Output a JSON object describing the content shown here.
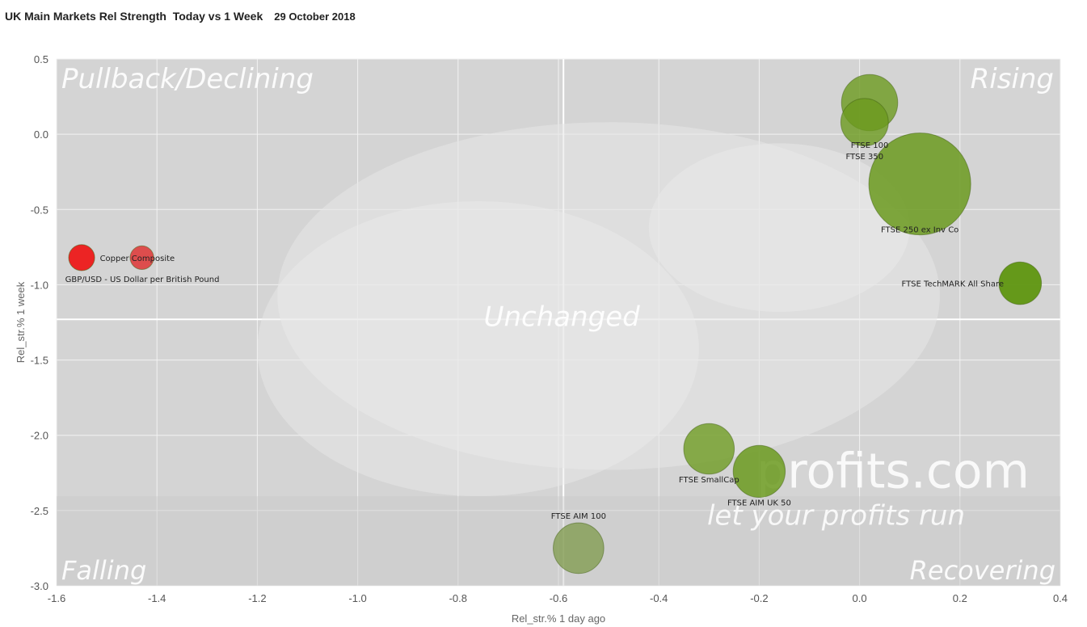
{
  "title": {
    "main": "UK Main Markets Rel Strength  Today vs 1 Week",
    "date": "29 October 2018"
  },
  "watermark": {
    "site": "profits.com",
    "tagline": "let your profits run"
  },
  "colors": {
    "plot_bg": "#d4d4d4",
    "grid": "#f2f2f2",
    "green": "#6b9a1e",
    "red": "#e82020"
  },
  "chart_data": {
    "type": "scatter",
    "title": "UK Main Markets Rel Strength  Today vs 1 Week",
    "xlabel": "Rel_str.% 1 day ago",
    "ylabel": "Rel_str.% 1 week",
    "xlim": [
      -1.6,
      0.4
    ],
    "ylim": [
      -3.0,
      0.5
    ],
    "x_ticks": [
      -1.6,
      -1.4,
      -1.2,
      -1.0,
      -0.8,
      -0.6,
      -0.4,
      -0.2,
      0.0,
      0.2,
      0.4
    ],
    "y_ticks": [
      0.5,
      0.0,
      -0.5,
      -1.0,
      -1.5,
      -2.0,
      -2.5,
      -3.0
    ],
    "x_tick_labels": [
      "-1.6",
      "-1.4",
      "-1.2",
      "-1.0",
      "-0.8",
      "-0.6",
      "-0.4",
      "-0.2",
      "0.0",
      "0.2",
      "0.4"
    ],
    "y_tick_labels": [
      "0.5",
      "0.0",
      "-0.5",
      "-1.0",
      "-1.5",
      "-2.0",
      "-2.5",
      "-3.0"
    ],
    "grid": true,
    "reference_lines": {
      "x": -0.59,
      "y": -1.23
    },
    "quadrants": {
      "top_left": "Pullback/Declining",
      "top_right": "Rising",
      "bottom_left": "Falling",
      "bottom_right": "Recovering",
      "center": "Unchanged"
    },
    "points": [
      {
        "label": "FTSE 100",
        "x": 0.02,
        "y": 0.21,
        "size": 2.1,
        "color": "#6b9a1e",
        "opacity": 0.8,
        "label_anchor": "below"
      },
      {
        "label": "FTSE 350",
        "x": 0.01,
        "y": 0.08,
        "size": 1.5,
        "color": "#6b9a1e",
        "opacity": 0.8,
        "label_anchor": "below"
      },
      {
        "label": "FTSE 250 ex Inv Co",
        "x": 0.12,
        "y": -0.33,
        "size": 6.9,
        "color": "#6b9a1e",
        "opacity": 0.85,
        "label_anchor": "below"
      },
      {
        "label": "FTSE TechMARK All Share",
        "x": 0.32,
        "y": -0.99,
        "size": 1.2,
        "color": "#5f9610",
        "opacity": 0.95,
        "label_anchor": "left"
      },
      {
        "label": "FTSE SmallCap",
        "x": -0.3,
        "y": -2.09,
        "size": 1.7,
        "color": "#6b9a1e",
        "opacity": 0.78,
        "label_anchor": "below"
      },
      {
        "label": "FTSE AIM UK 50",
        "x": -0.2,
        "y": -2.24,
        "size": 1.8,
        "color": "#6b9a1e",
        "opacity": 0.85,
        "label_anchor": "below"
      },
      {
        "label": "FTSE AIM 100",
        "x": -0.56,
        "y": -2.75,
        "size": 1.7,
        "color": "#7d9a4a",
        "opacity": 0.75,
        "label_anchor": "above"
      },
      {
        "label": "Copper Composite",
        "x": -1.43,
        "y": -0.82,
        "size": 0.37,
        "color": "#e02020",
        "opacity": 0.75,
        "label_anchor": "left"
      },
      {
        "label": "GBP/USD - US Dollar per British Pound",
        "x": -1.55,
        "y": -0.82,
        "size": 0.45,
        "color": "#ee1111",
        "opacity": 0.9,
        "label_anchor": "below"
      }
    ]
  }
}
